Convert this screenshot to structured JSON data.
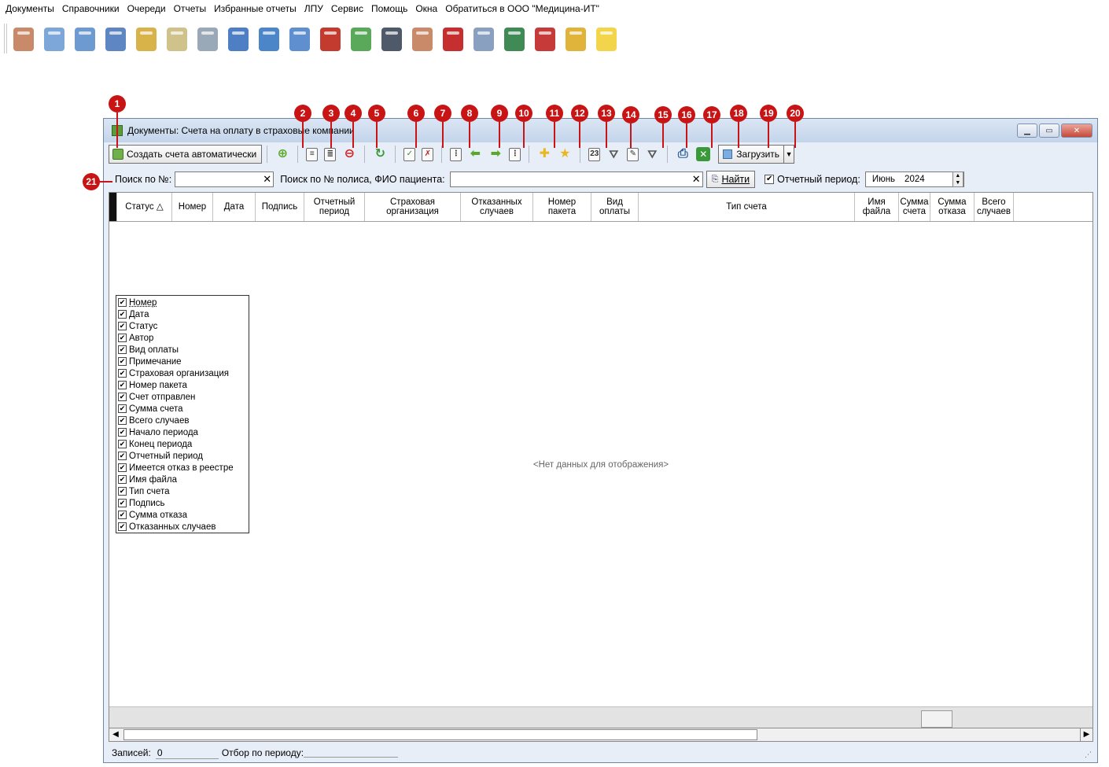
{
  "menu": [
    "Документы",
    "Справочники",
    "Очереди",
    "Отчеты",
    "Избранные отчеты",
    "ЛПУ",
    "Сервис",
    "Помощь",
    "Окна",
    "Обратиться в ООО \"Медицина-ИТ\""
  ],
  "big_toolbar_icons": [
    {
      "name": "doctor-icon",
      "color": "#c98a6a"
    },
    {
      "name": "notebook-icon",
      "color": "#7da7d9"
    },
    {
      "name": "document-icon",
      "color": "#6d9bd1"
    },
    {
      "name": "card-index-icon",
      "color": "#5d86c2"
    },
    {
      "name": "books-icon",
      "color": "#d8b34a"
    },
    {
      "name": "notepad-icon",
      "color": "#cfc28a"
    },
    {
      "name": "syringe-icon",
      "color": "#9aa9b8"
    },
    {
      "name": "calendar-icon",
      "color": "#4e7fc4"
    },
    {
      "name": "pharmacy-icon",
      "color": "#4a86c8"
    },
    {
      "name": "first-aid-icon",
      "color": "#5f8fcf"
    },
    {
      "name": "supplies-icon",
      "color": "#c23b2e"
    },
    {
      "name": "mortar-icon",
      "color": "#5aa85a"
    },
    {
      "name": "barcode-scanner-icon",
      "color": "#4e5a6a"
    },
    {
      "name": "nurse-icon",
      "color": "#c98a6a"
    },
    {
      "name": "red-book-icon",
      "color": "#c52f2f"
    },
    {
      "name": "calendar-clock-icon",
      "color": "#8aa0c0"
    },
    {
      "name": "lock-folder-icon",
      "color": "#3f8a55"
    },
    {
      "name": "red-folder-icon",
      "color": "#c63a3a"
    },
    {
      "name": "padlock-icon",
      "color": "#e0b43a"
    },
    {
      "name": "chat-bubble-icon",
      "color": "#f2d54a"
    }
  ],
  "window": {
    "title": "Документы: Счета на оплату в страховые компании"
  },
  "toolbar": {
    "auto_create_label": "Создать счета автоматически",
    "load_label": "Загрузить",
    "load_hotkey": "З"
  },
  "search": {
    "policy_num_label": "Поиск по №:",
    "policy_fio_label": "Поиск по № полиса, ФИО пациента:",
    "find_label": "Найти",
    "report_period_label": "Отчетный период:",
    "month": "Июнь",
    "year": "2024"
  },
  "columns": [
    "Статус",
    "Номер",
    "Дата",
    "Подпись",
    "Отчетный период",
    "Страховая организация",
    "Отказанных случаев",
    "Номер пакета",
    "Вид оплаты",
    "Тип счета",
    "Имя файла",
    "Сумма счета",
    "Сумма отказа",
    "Всего случаев"
  ],
  "column_chooser": [
    "Номер",
    "Дата",
    "Статус",
    "Автор",
    "Вид оплаты",
    "Примечание",
    "Страховая организация",
    "Номер пакета",
    "Счет отправлен",
    "Сумма счета",
    "Всего случаев",
    "Начало периода",
    "Конец периода",
    "Отчетный период",
    "Имеется отказ в реестре",
    "Имя файла",
    "Тип счета",
    "Подпись",
    "Сумма отказа",
    "Отказанных случаев"
  ],
  "empty_text": "<Нет данных для отображения>",
  "status": {
    "records_label": "Записей:",
    "records_value": "0",
    "period_filter_label": "Отбор по периоду:"
  },
  "callouts": [
    "1",
    "2",
    "3",
    "4",
    "5",
    "6",
    "7",
    "8",
    "9",
    "10",
    "11",
    "12",
    "13",
    "14",
    "15",
    "16",
    "17",
    "18",
    "19",
    "20",
    "21"
  ],
  "colors": {
    "callout": "#c81414",
    "green_arrow": "#5aa82a",
    "title_gradient_top": "#dbe6f4"
  }
}
